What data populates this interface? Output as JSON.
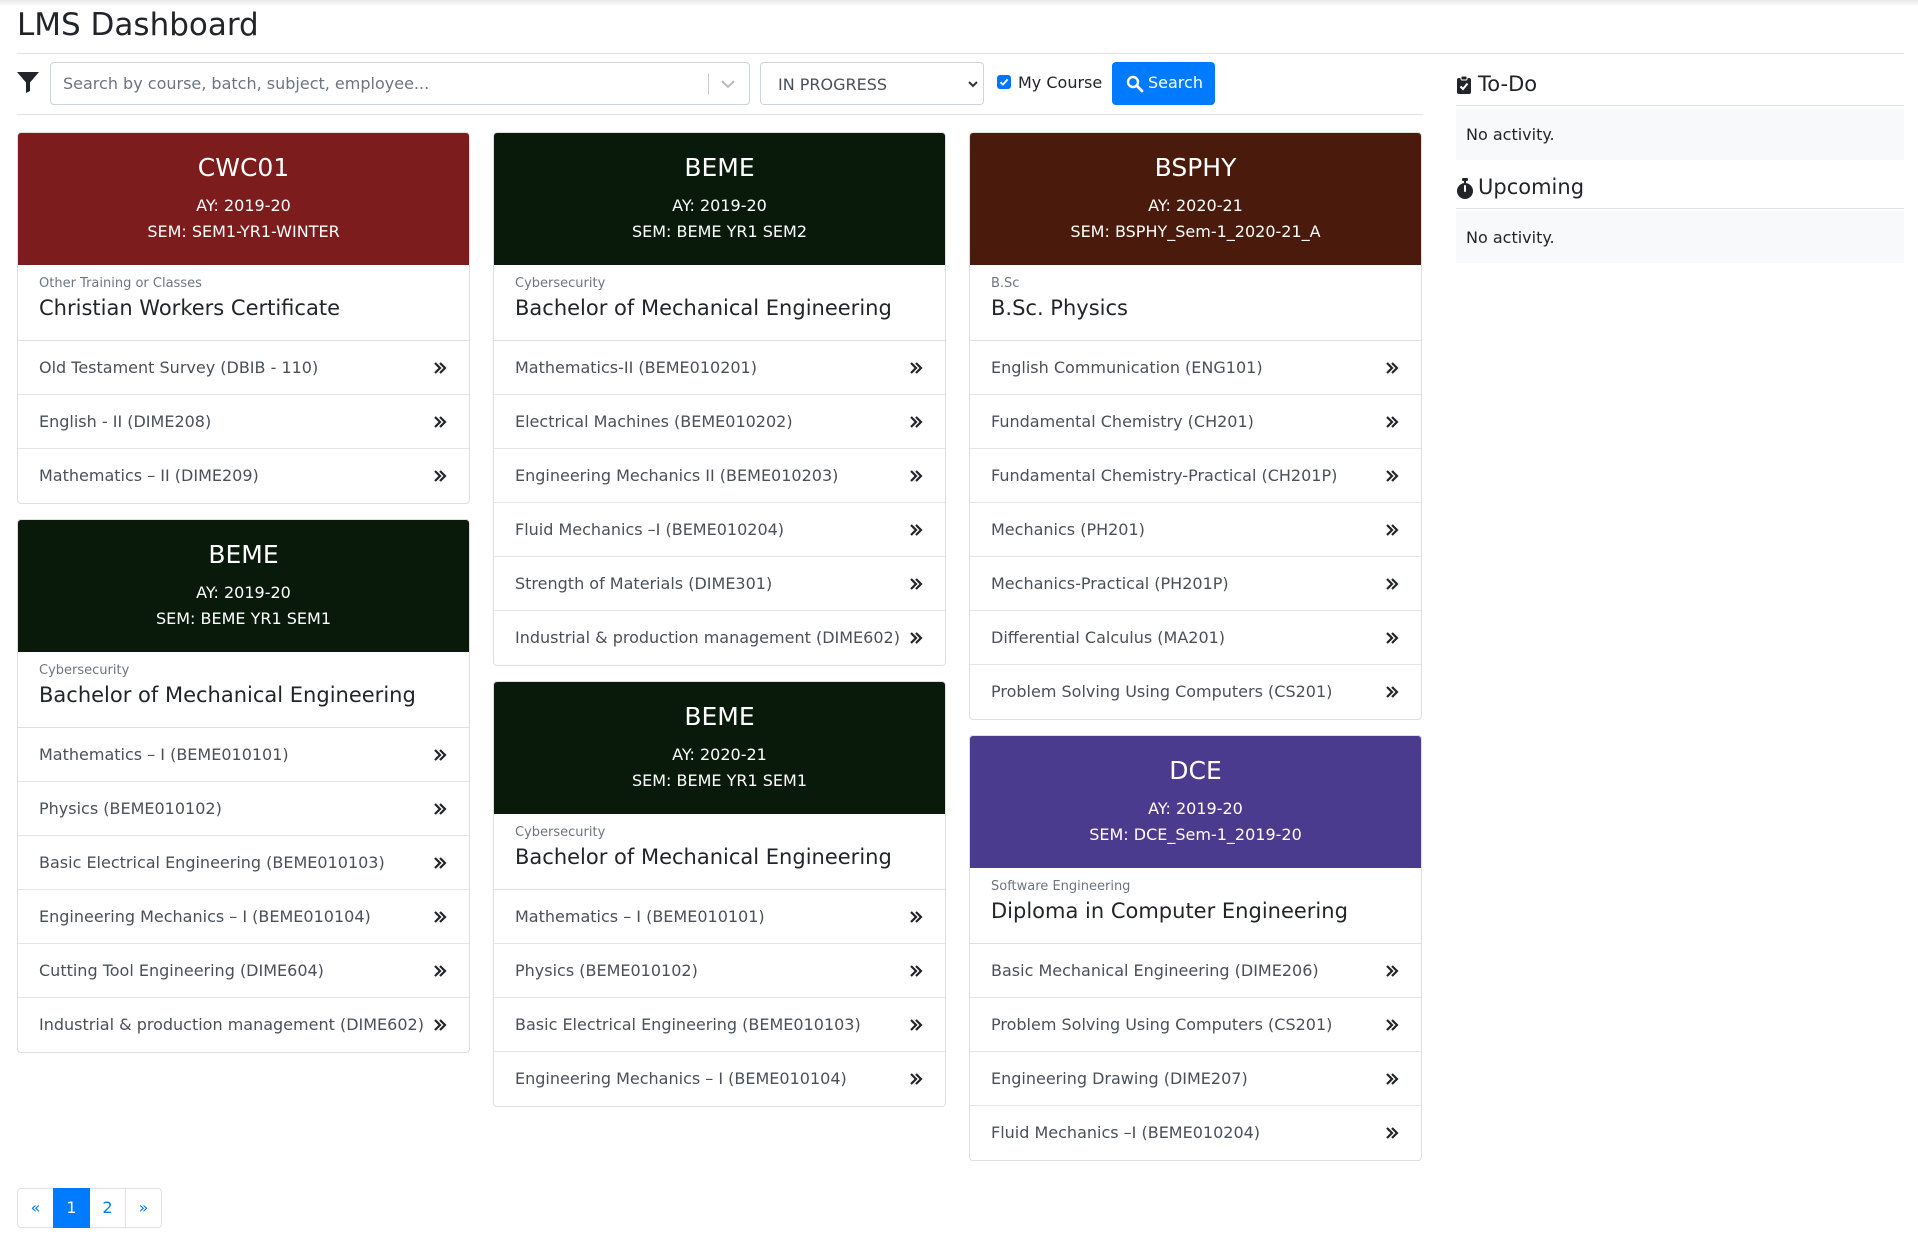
{
  "header": {
    "title": "LMS Dashboard"
  },
  "filters": {
    "search_placeholder": "Search by course, batch, subject, employee...",
    "status_value": "IN PROGRESS",
    "my_course_label": "My Course",
    "my_course_checked": true,
    "search_button_label": "Search"
  },
  "colors": {
    "primary": "#007bff",
    "maroon": "#7c1c1d",
    "darkgreen": "#091a0a",
    "brown": "#4a1a0c",
    "purple": "#4a3b8f"
  },
  "columns": [
    {
      "cards": [
        {
          "code": "CWC01",
          "ay": "AY: 2019-20",
          "sem": "SEM: SEM1-YR1-WINTER",
          "color": "#7c1c1d",
          "category": "Other Training or Classes",
          "program": "Christian Workers Certificate",
          "subjects": [
            "Old Testament Survey (DBIB - 110)",
            "English - II (DIME208)",
            "Mathematics – II (DIME209)"
          ]
        },
        {
          "code": "BEME",
          "ay": "AY: 2019-20",
          "sem": "SEM: BEME YR1 SEM1",
          "color": "#091a0a",
          "category": "Cybersecurity",
          "program": "Bachelor of Mechanical Engineering",
          "subjects": [
            "Mathematics – I (BEME010101)",
            "Physics (BEME010102)",
            "Basic Electrical Engineering (BEME010103)",
            "Engineering Mechanics – I (BEME010104)",
            "Cutting Tool Engineering (DIME604)",
            "Industrial & production management (DIME602)"
          ]
        }
      ]
    },
    {
      "cards": [
        {
          "code": "BEME",
          "ay": "AY: 2019-20",
          "sem": "SEM: BEME YR1 SEM2",
          "color": "#091a0a",
          "category": "Cybersecurity",
          "program": "Bachelor of Mechanical Engineering",
          "subjects": [
            "Mathematics-II (BEME010201)",
            "Electrical Machines (BEME010202)",
            "Engineering Mechanics II (BEME010203)",
            "Fluid Mechanics –I (BEME010204)",
            "Strength of Materials (DIME301)",
            "Industrial & production management (DIME602)"
          ]
        },
        {
          "code": "BEME",
          "ay": "AY: 2020-21",
          "sem": "SEM: BEME YR1 SEM1",
          "color": "#091a0a",
          "category": "Cybersecurity",
          "program": "Bachelor of Mechanical Engineering",
          "subjects": [
            "Mathematics – I (BEME010101)",
            "Physics (BEME010102)",
            "Basic Electrical Engineering (BEME010103)",
            "Engineering Mechanics – I (BEME010104)"
          ]
        }
      ]
    },
    {
      "cards": [
        {
          "code": "BSPHY",
          "ay": "AY: 2020-21",
          "sem": "SEM: BSPHY_Sem-1_2020-21_A",
          "color": "#4a1a0c",
          "category": "B.Sc",
          "program": "B.Sc. Physics",
          "subjects": [
            "English Communication (ENG101)",
            "Fundamental Chemistry (CH201)",
            "Fundamental Chemistry-Practical (CH201P)",
            "Mechanics (PH201)",
            "Mechanics-Practical (PH201P)",
            "Differential Calculus (MA201)",
            "Problem Solving Using Computers (CS201)"
          ]
        },
        {
          "code": "DCE",
          "ay": "AY: 2019-20",
          "sem": "SEM: DCE_Sem-1_2019-20",
          "color": "#4a3b8f",
          "category": "Software Engineering",
          "program": "Diploma in Computer Engineering",
          "subjects": [
            "Basic Mechanical Engineering (DIME206)",
            "Problem Solving Using Computers (CS201)",
            "Engineering Drawing (DIME207)",
            "Fluid Mechanics –I (BEME010204)"
          ]
        }
      ]
    }
  ],
  "sidebar": {
    "todo": {
      "title": "To-Do",
      "text": "No activity."
    },
    "upcoming": {
      "title": "Upcoming",
      "text": "No activity."
    }
  },
  "pagination": {
    "prev": "«",
    "pages": [
      "1",
      "2"
    ],
    "active": "1",
    "next": "»"
  }
}
